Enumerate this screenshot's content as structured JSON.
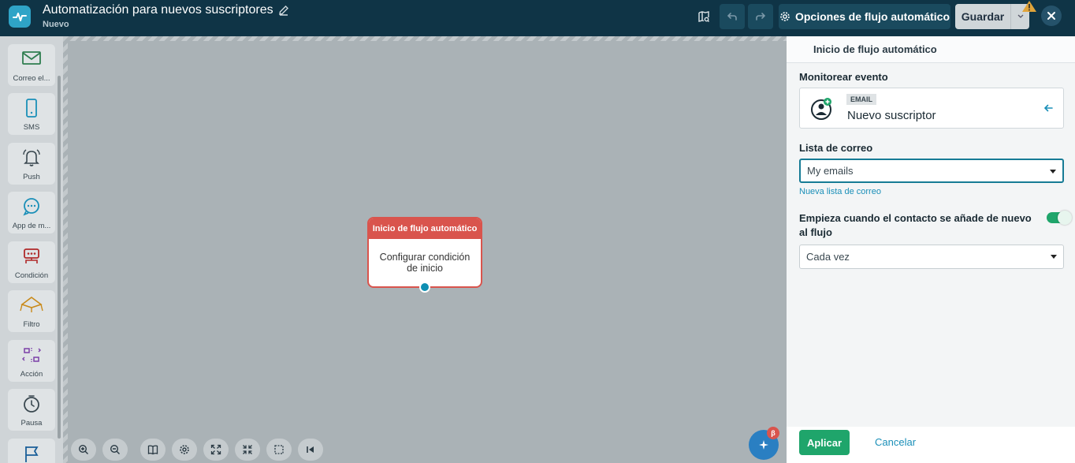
{
  "header": {
    "title": "Automatización para nuevos suscriptores",
    "status": "Nuevo",
    "options_label": "Opciones de flujo automático",
    "save_label": "Guardar"
  },
  "palette": {
    "items": [
      {
        "label": "Correo el...",
        "icon": "email-icon",
        "color": "#2e7d4f"
      },
      {
        "label": "SMS",
        "icon": "phone-icon",
        "color": "#1a8fb8"
      },
      {
        "label": "Push",
        "icon": "bell-icon",
        "color": "#3a4850"
      },
      {
        "label": "App de m...",
        "icon": "chat-icon",
        "color": "#1a8fb8"
      },
      {
        "label": "Condición",
        "icon": "condition-icon",
        "color": "#b02a2a"
      },
      {
        "label": "Filtro",
        "icon": "filter-icon",
        "color": "#c98a1a"
      },
      {
        "label": "Acción",
        "icon": "action-icon",
        "color": "#7b3fa8"
      },
      {
        "label": "Pausa",
        "icon": "timer-icon",
        "color": "#3a4850"
      },
      {
        "label": "",
        "icon": "flag-icon",
        "color": "#1a5f99"
      }
    ]
  },
  "canvas": {
    "node": {
      "title": "Inicio de flujo automático",
      "body": "Configurar condición de inicio"
    },
    "ai_badge": "β"
  },
  "panel": {
    "title": "Inicio de flujo automático",
    "monitor_label": "Monitorear evento",
    "event": {
      "badge": "EMAIL",
      "name": "Nuevo suscriptor"
    },
    "list_label": "Lista de correo",
    "list_value": "My emails",
    "new_list_link": "Nueva lista de correo",
    "restart_label": "Empieza cuando el contacto se añade de nuevo al flujo",
    "restart_enabled": true,
    "frequency_value": "Cada vez",
    "apply_label": "Aplicar",
    "cancel_label": "Cancelar"
  }
}
